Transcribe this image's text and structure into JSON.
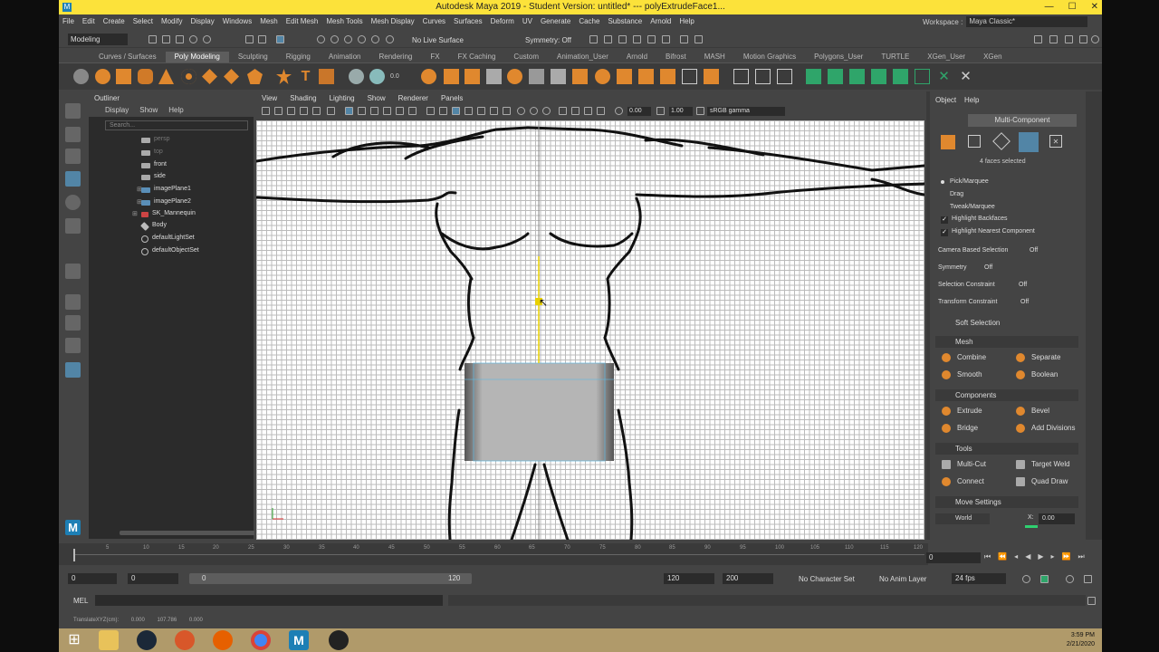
{
  "window": {
    "title": "Autodesk Maya 2019 - Student Version: untitled*   ---   polyExtrudeFace1..."
  },
  "menubar": [
    "File",
    "Edit",
    "Create",
    "Select",
    "Modify",
    "Display",
    "Windows",
    "Mesh",
    "Edit Mesh",
    "Mesh Tools",
    "Mesh Display",
    "Curves",
    "Surfaces",
    "Deform",
    "UV",
    "Generate",
    "Cache",
    "Substance",
    "Arnold",
    "Help"
  ],
  "workspace": {
    "label": "Workspace :",
    "value": "Maya Classic*"
  },
  "status_line": {
    "mode": "Modeling",
    "live": "No Live Surface",
    "symmetry": "Symmetry: Off"
  },
  "shelf_tabs": [
    "Curves / Surfaces",
    "Poly Modeling",
    "Sculpting",
    "Rigging",
    "Animation",
    "Rendering",
    "FX",
    "FX Caching",
    "Custom",
    "Animation_User",
    "Arnold",
    "Bifrost",
    "MASH",
    "Motion Graphics",
    "Polygons_User",
    "TURTLE",
    "XGen_User",
    "XGen"
  ],
  "shelf_active": "Poly Modeling",
  "outliner": {
    "title": "Outliner",
    "menu": [
      "Display",
      "Show",
      "Help"
    ],
    "search_placeholder": "Search...",
    "items": [
      {
        "label": "persp",
        "dim": true
      },
      {
        "label": "top",
        "dim": true
      },
      {
        "label": "front",
        "dim": false
      },
      {
        "label": "side",
        "dim": false
      },
      {
        "label": "imagePlane1",
        "dim": false
      },
      {
        "label": "imagePlane2",
        "dim": false
      },
      {
        "label": "SK_Mannequin",
        "dim": false
      },
      {
        "label": "Body",
        "dim": false
      },
      {
        "label": "defaultLightSet",
        "dim": false
      },
      {
        "label": "defaultObjectSet",
        "dim": false
      }
    ]
  },
  "viewport": {
    "menu": [
      "View",
      "Shading",
      "Lighting",
      "Show",
      "Renderer",
      "Panels"
    ],
    "exposure": "0.00",
    "gamma": "1.00",
    "color_space": "sRGB gamma"
  },
  "modeling_toolkit": {
    "tabs": [
      "Object",
      "Help"
    ],
    "mode_button": "Multi-Component",
    "selection_info": "4 faces selected",
    "pick_options": [
      "Pick/Marquee",
      "Drag",
      "Tweak/Marquee"
    ],
    "checks": [
      "Highlight Backfaces",
      "Highlight Nearest Component"
    ],
    "settings": [
      {
        "label": "Camera Based Selection",
        "value": "Off"
      },
      {
        "label": "Symmetry",
        "value": "Off"
      },
      {
        "label": "Selection Constraint",
        "value": "Off"
      },
      {
        "label": "Transform Constraint",
        "value": "Off"
      }
    ],
    "soft_selection": "Soft Selection",
    "sections": {
      "mesh": {
        "title": "Mesh",
        "buttons": [
          "Combine",
          "Separate",
          "Smooth",
          "Boolean"
        ]
      },
      "components": {
        "title": "Components",
        "buttons": [
          "Extrude",
          "Bevel",
          "Bridge",
          "Add Divisions"
        ]
      },
      "tools": {
        "title": "Tools",
        "buttons": [
          "Multi-Cut",
          "Target Weld",
          "Connect",
          "Quad Draw"
        ]
      }
    },
    "move_settings": "Move Settings",
    "world": "World",
    "x_label": "X:",
    "x_value": "0.00"
  },
  "timeline": {
    "ticks": [
      "5",
      "10",
      "15",
      "20",
      "25",
      "30",
      "35",
      "40",
      "45",
      "50",
      "55",
      "60",
      "65",
      "70",
      "75",
      "80",
      "85",
      "90",
      "95",
      "100",
      "105",
      "110",
      "115",
      "120"
    ],
    "current_frame": "0"
  },
  "range": {
    "start": "0",
    "anim_start": "0",
    "slider_start": "0",
    "slider_end": "120",
    "end": "120",
    "anim_end": "200",
    "character_set": "No Character Set",
    "anim_layer": "No Anim Layer",
    "fps": "24 fps"
  },
  "command": {
    "lang": "MEL"
  },
  "help_line": {
    "label": "TranslateXYZ(cm):",
    "x": "0.000",
    "y": "107.786",
    "z": "0.000"
  },
  "taskbar": {
    "time": "3:59 PM",
    "date": "2/21/2020"
  },
  "colors": {
    "title_bar": "#fce23a",
    "ui_bg": "#444444",
    "panel_dark": "#2b2b2b",
    "accent_orange": "#e0882e",
    "selection_blue": "#5285a6"
  }
}
